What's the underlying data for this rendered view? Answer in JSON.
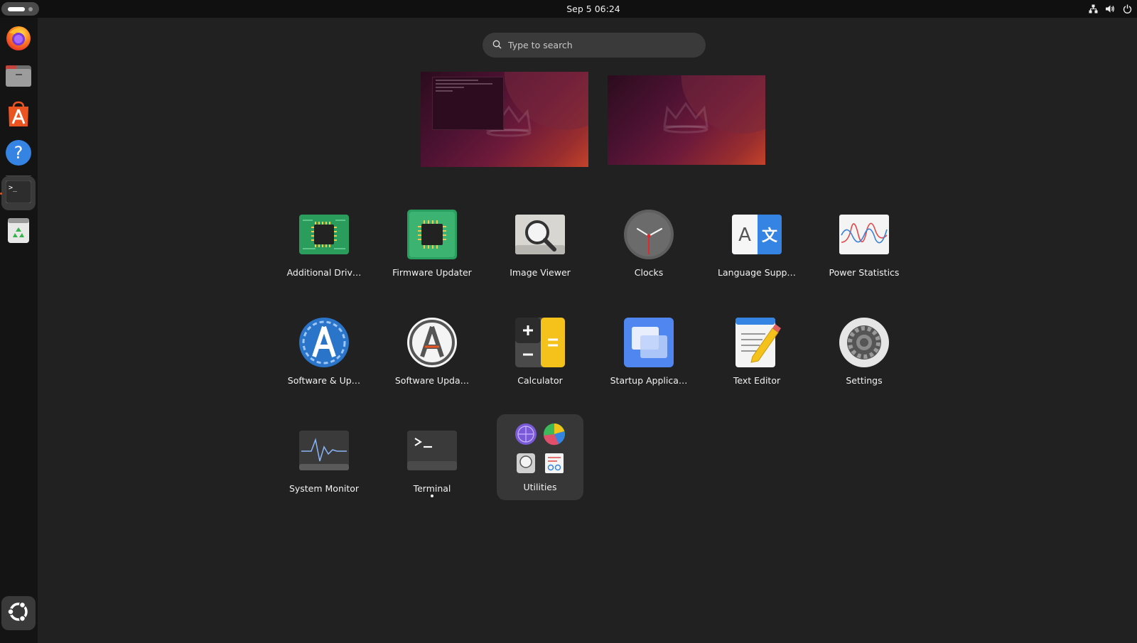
{
  "topbar": {
    "datetime": "Sep 5  06:24",
    "tray_icons": [
      "network-icon",
      "volume-icon",
      "power-icon"
    ]
  },
  "dock": {
    "items": [
      {
        "name": "Firefox",
        "icon": "firefox-icon",
        "running": false
      },
      {
        "name": "Files",
        "icon": "files-icon",
        "running": false
      },
      {
        "name": "App Center",
        "icon": "app-center-icon",
        "running": false
      },
      {
        "name": "Help",
        "icon": "help-icon",
        "running": false
      },
      {
        "name": "Terminal",
        "icon": "terminal-icon",
        "running": true
      },
      {
        "name": "Trash",
        "icon": "trash-icon",
        "running": false
      }
    ],
    "show_apps_icon": "ubuntu-logo-icon"
  },
  "search": {
    "placeholder": "Type to search",
    "value": ""
  },
  "workspaces": {
    "count": 2,
    "active": 1
  },
  "apps": [
    {
      "label": "Additional Driv…",
      "icon": "chip-green-icon"
    },
    {
      "label": "Firmware Updater",
      "icon": "chip-firmware-icon"
    },
    {
      "label": "Image Viewer",
      "icon": "magnifier-image-icon"
    },
    {
      "label": "Clocks",
      "icon": "clock-icon"
    },
    {
      "label": "Language Supp…",
      "icon": "language-icon"
    },
    {
      "label": "Power Statistics",
      "icon": "power-graph-icon"
    },
    {
      "label": "Software & Up…",
      "icon": "software-sources-icon"
    },
    {
      "label": "Software Upda…",
      "icon": "software-updater-icon"
    },
    {
      "label": "Calculator",
      "icon": "calculator-icon"
    },
    {
      "label": "Startup Applica…",
      "icon": "startup-apps-icon"
    },
    {
      "label": "Text Editor",
      "icon": "text-editor-icon"
    },
    {
      "label": "Settings",
      "icon": "settings-gear-icon"
    },
    {
      "label": "System Monitor",
      "icon": "system-monitor-icon"
    },
    {
      "label": "Terminal",
      "icon": "terminal-icon",
      "running": true
    },
    {
      "label": "Utilities",
      "icon": "folder-icon",
      "is_folder": true
    }
  ],
  "colors": {
    "background": "#212121",
    "topbar": "#101010",
    "dock": "#141414",
    "accent": "#e95420",
    "search_bg": "#3a3a3a"
  }
}
